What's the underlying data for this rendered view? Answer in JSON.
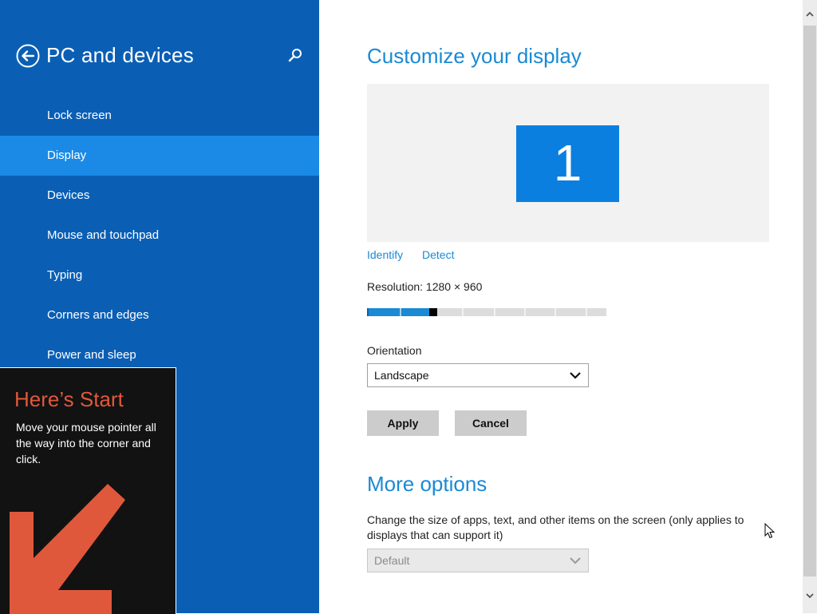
{
  "header": {
    "title": "PC and devices",
    "back_icon": "back-arrow-icon",
    "search_icon": "search-icon"
  },
  "sidebar": {
    "items": [
      {
        "label": "Lock screen",
        "selected": false
      },
      {
        "label": "Display",
        "selected": true
      },
      {
        "label": "Devices",
        "selected": false
      },
      {
        "label": "Mouse and touchpad",
        "selected": false
      },
      {
        "label": "Typing",
        "selected": false
      },
      {
        "label": "Corners and edges",
        "selected": false
      },
      {
        "label": "Power and sleep",
        "selected": false
      }
    ]
  },
  "start_tip": {
    "title": "Here’s Start",
    "text": "Move your mouse pointer all the way into the corner and click.",
    "arrow_color": "#e0583b"
  },
  "main": {
    "title": "Customize your display",
    "monitor_number": "1",
    "identify_label": "Identify",
    "detect_label": "Detect",
    "resolution_label": "Resolution: 1280 × 960",
    "resolution_slider": {
      "segments": 8,
      "filled_fraction": 0.27
    },
    "orientation_label": "Orientation",
    "orientation_value": "Landscape",
    "apply_label": "Apply",
    "cancel_label": "Cancel",
    "more_options_title": "More options",
    "scale_description": "Change the size of apps, text, and other items on the screen (only applies to displays that can support it)",
    "scale_value": "Default"
  },
  "colors": {
    "sidebar_bg": "#0a5fb5",
    "sidebar_selected": "#1a8ae6",
    "accent": "#1a8ad4",
    "monitor": "#0a7fe0"
  }
}
